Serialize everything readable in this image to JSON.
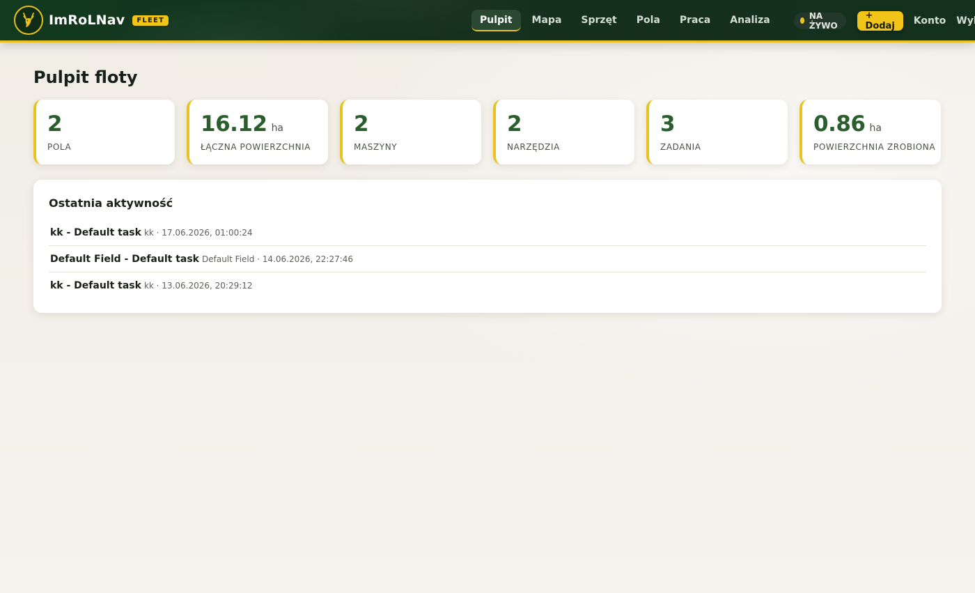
{
  "navbar": {
    "brand": "ImRoLNav",
    "badge": "FLEET",
    "logo_icon": "deer-icon",
    "links": [
      {
        "label": "Pulpit",
        "active": true
      },
      {
        "label": "Mapa",
        "active": false
      },
      {
        "label": "Sprzęt",
        "active": false
      },
      {
        "label": "Pola",
        "active": false
      },
      {
        "label": "Praca",
        "active": false
      },
      {
        "label": "Analiza",
        "active": false
      }
    ],
    "live_label": "NA ŻYWO",
    "add_label": "+ Dodaj",
    "account_label": "Konto",
    "logout_label": "Wyloguj"
  },
  "page": {
    "title": "Pulpit floty"
  },
  "stats": [
    {
      "value": "2",
      "unit": "",
      "label": "POLA"
    },
    {
      "value": "16.12",
      "unit": "ha",
      "label": "ŁĄCZNA POWIERZCHNIA"
    },
    {
      "value": "2",
      "unit": "",
      "label": "MASZYNY"
    },
    {
      "value": "2",
      "unit": "",
      "label": "NARZĘDZIA"
    },
    {
      "value": "3",
      "unit": "",
      "label": "ZADANIA"
    },
    {
      "value": "0.86",
      "unit": "ha",
      "label": "POWIERZCHNIA ZROBIONA"
    }
  ],
  "activity": {
    "title": "Ostatnia aktywność",
    "items": [
      {
        "name": "kk - Default task",
        "meta": "kk · 17.06.2026, 01:00:24"
      },
      {
        "name": "Default Field - Default task",
        "meta": "Default Field · 14.06.2026, 22:27:46"
      },
      {
        "name": "kk - Default task",
        "meta": "kk · 13.06.2026, 20:29:12"
      }
    ]
  },
  "colors": {
    "nav_bg": "#13311d",
    "accent": "#f0c419",
    "stat_value": "#2a5e2c"
  }
}
